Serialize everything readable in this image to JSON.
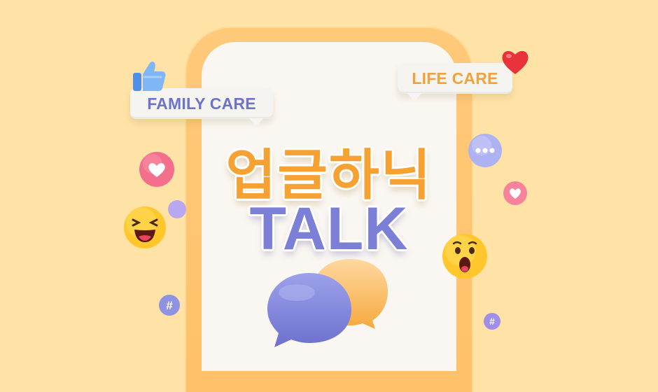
{
  "tags": {
    "family": "FAMILY CARE",
    "life": "LIFE CARE"
  },
  "title": {
    "korean": "업글하닉",
    "english": "TALK"
  },
  "icons": {
    "thumbs_up": "thumbs-up-icon",
    "heart": "heart-icon",
    "laughing_emoji": "laughing-emoji-icon",
    "surprised_emoji": "surprised-emoji-icon",
    "typing": "typing-dots-icon",
    "hashtag": "hashtag-icon",
    "chat_bubbles": "chat-bubbles-icon",
    "hashtag_symbol": "#"
  },
  "colors": {
    "background": "#FFE3A6",
    "phone_frame": "#FFC16A",
    "accent_orange": "#F6A232",
    "accent_purple": "#7B80D6",
    "heart_pink": "#F26B8A"
  }
}
